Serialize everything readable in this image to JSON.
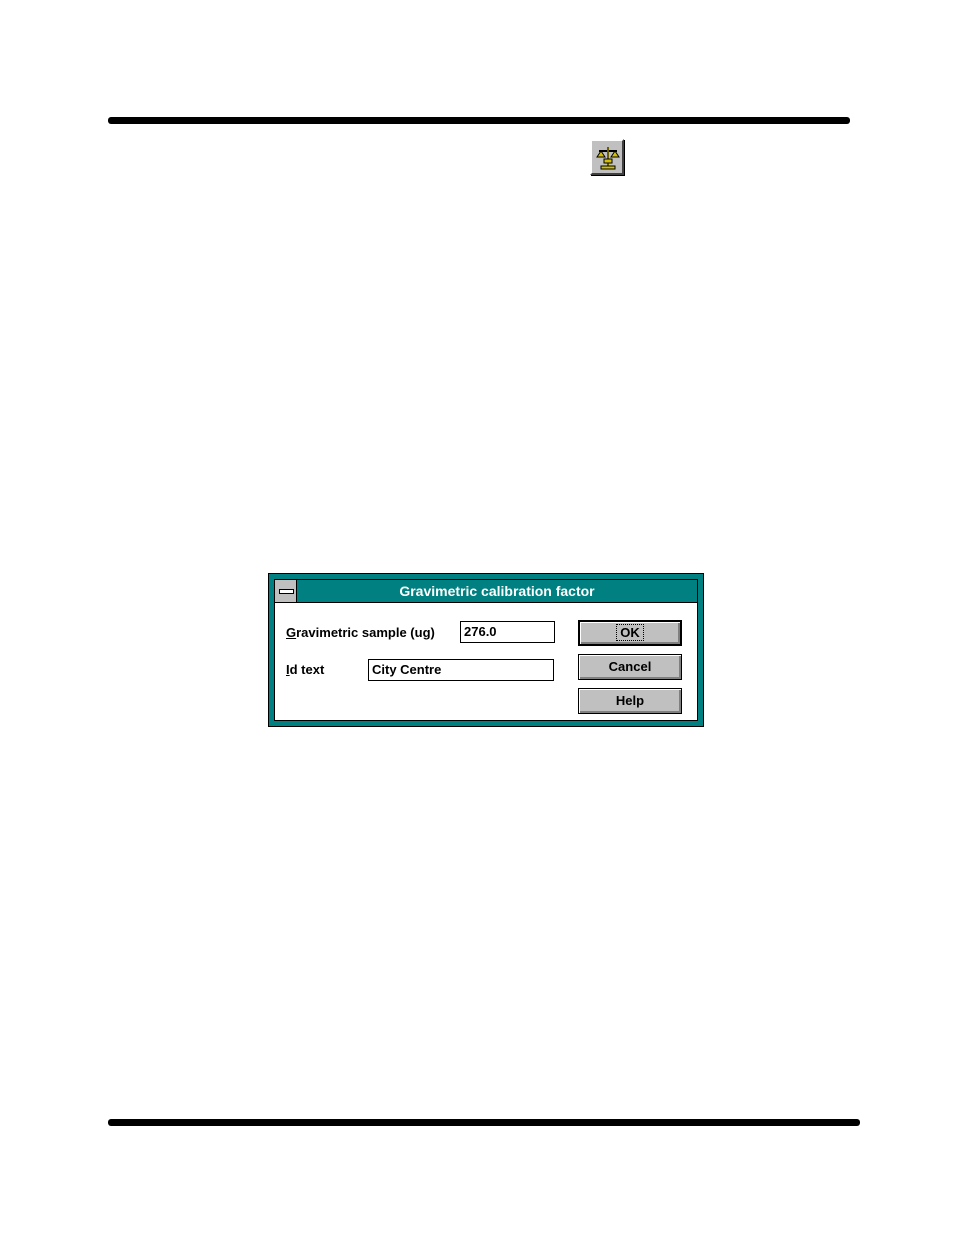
{
  "toolbar": {
    "icon": "balance-scale-icon"
  },
  "dialog": {
    "title": "Gravimetric calibration factor",
    "fields": {
      "gravimetric_sample": {
        "label_accel": "G",
        "label_rest": "ravimetric sample (ug)",
        "value": "276.0"
      },
      "id_text": {
        "label_accel": "I",
        "label_rest": "d text",
        "value": "City Centre"
      }
    },
    "buttons": {
      "ok": "OK",
      "cancel": "Cancel",
      "help": "Help"
    }
  },
  "colors": {
    "titlebar": "#008080",
    "face": "#c0c0c0",
    "icon_gold": "#d4c000"
  }
}
